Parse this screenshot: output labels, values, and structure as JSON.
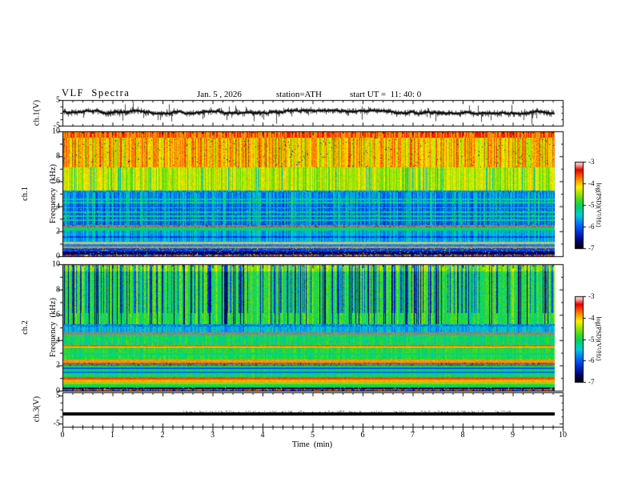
{
  "header": {
    "title": "VLF  Spectra",
    "date": "Jan. 5 , 2026",
    "station": "station=ATH",
    "start_ut": "start UT =  11: 40: 0"
  },
  "x_axis": {
    "label": "Time  (min)",
    "tick_labels": [
      "0",
      "1",
      "2",
      "3",
      "4",
      "5",
      "6",
      "7",
      "8",
      "9",
      "10"
    ]
  },
  "panels": {
    "ch1_wave": {
      "ylabel": "ch.1(V)",
      "ytick_labels": [
        "5",
        "-5"
      ]
    },
    "ch1_spec": {
      "ylabel_line1": "ch.1",
      "ylabel_line2": "Frequency  (kHz)",
      "ytick_labels": [
        "10",
        "8",
        "6",
        "4",
        "2",
        "0"
      ]
    },
    "ch2_spec": {
      "ylabel_line1": "ch.2",
      "ylabel_line2": "Frequency  (kHz)",
      "ytick_labels": [
        "10",
        "8",
        "6",
        "4",
        "2",
        "0"
      ]
    },
    "ch3_wave": {
      "ylabel": "ch.3(V)",
      "ytick_labels": [
        "5",
        "-5"
      ]
    }
  },
  "colorbars": {
    "label": "log(PSD)(V²/Hz)",
    "tick_labels": [
      "-3",
      "-4",
      "-5",
      "-6",
      "-7"
    ]
  },
  "chart_data": {
    "type": "heatmap",
    "title": "VLF Spectra",
    "date": "Jan. 5, 2026",
    "station": "ATH",
    "start_ut": "11:40:0",
    "xlabel": "Time (min)",
    "x_range": [
      0,
      10
    ],
    "data_time_extent_min": [
      0,
      9.8
    ],
    "panels": [
      {
        "type": "line",
        "name": "ch.1 waveform",
        "ylabel": "ch.1(V)",
        "ylim": [
          -5,
          5
        ],
        "summary": "Continuous broadband noisy voltage trace centered near +0.4 V with ~±1 V envelope and frequent impulsive spikes reaching -5 and +5 V over 0–9.8 min"
      },
      {
        "type": "heatmap",
        "name": "ch.1 spectrogram",
        "ylabel": "Frequency (kHz)",
        "ylim": [
          0,
          10
        ],
        "colorbar_label": "log(PSD)(V²/Hz)",
        "colorbar_range": [
          -7,
          -3
        ],
        "bands": [
          {
            "f_khz": [
              9.6,
              10.0
            ],
            "log_psd": -3.5,
            "note": "solid red/orange band"
          },
          {
            "f_khz": [
              7.2,
              9.6
            ],
            "log_psd": -4.0,
            "note": "orange-yellow with red and green vertical streaks"
          },
          {
            "f_khz": [
              5.3,
              7.2
            ],
            "log_psd": -4.4,
            "note": "yellow-green with dense green vertical striations"
          },
          {
            "f_khz": [
              5.1,
              5.3
            ],
            "log_psd": -6.2,
            "note": "dark horizontal line"
          },
          {
            "f_khz": [
              2.5,
              5.1
            ],
            "log_psd": -5.8,
            "note": "blue region, navy vertical streaks, cyan lines near 2.9/3.2/3.6/3.9/4.6 kHz"
          },
          {
            "f_khz": [
              2.3,
              2.5
            ],
            "log_psd": -4.8,
            "note": "grey-brown band"
          },
          {
            "f_khz": [
              2.05,
              2.3
            ],
            "log_psd": -5.1,
            "note": "cyan-green line"
          },
          {
            "f_khz": [
              1.1,
              2.05
            ],
            "log_psd": -5.6,
            "note": "blue speckle"
          },
          {
            "f_khz": [
              0.95,
              1.1
            ],
            "log_psd": -4.4,
            "note": "pale yellow-grey band"
          },
          {
            "f_khz": [
              0.6,
              0.72
            ],
            "log_psd": -3.8,
            "note": "orange line"
          },
          {
            "f_khz": [
              0.1,
              0.6
            ],
            "log_psd": -6.6,
            "note": "near-black band with sparse bright speckle"
          },
          {
            "f_khz": [
              0.0,
              0.1
            ],
            "log_psd": -5.5,
            "note": "mixed colored edge line"
          }
        ]
      },
      {
        "type": "heatmap",
        "name": "ch.2 spectrogram",
        "ylabel": "Frequency (kHz)",
        "ylim": [
          0,
          10
        ],
        "colorbar_label": "log(PSD)(V²/Hz)",
        "colorbar_range": [
          -7,
          -3
        ],
        "bands": [
          {
            "f_khz": [
              5.3,
              10.0
            ],
            "log_psd": -4.9,
            "note": "green/cyan with many dark navy-black vertical dropout streaks to -7"
          },
          {
            "f_khz": [
              5.1,
              5.3
            ],
            "log_psd": -6.2,
            "note": "dark horizontal line"
          },
          {
            "f_khz": [
              4.6,
              5.1
            ],
            "log_psd": -5.6,
            "note": "blue-cyan speckle band"
          },
          {
            "f_khz": [
              4.45,
              4.6
            ],
            "log_psd": -4.8,
            "note": "grey band"
          },
          {
            "f_khz": [
              3.65,
              4.45
            ],
            "log_psd": -5.0,
            "note": "green with blue speckle"
          },
          {
            "f_khz": [
              3.4,
              3.65
            ],
            "log_psd": -3.8,
            "note": "orange-red line over yellow"
          },
          {
            "f_khz": [
              2.45,
              3.4
            ],
            "log_psd": -4.9,
            "note": "green speckle"
          },
          {
            "f_khz": [
              2.25,
              2.45
            ],
            "log_psd": -3.9,
            "note": "orange line"
          },
          {
            "f_khz": [
              2.0,
              2.25
            ],
            "log_psd": -5.2,
            "note": "grey-dark band"
          },
          {
            "f_khz": [
              1.05,
              2.0
            ],
            "log_psd": -5.0,
            "note": "green with dark lines at 1.45 and 1.75 kHz"
          },
          {
            "f_khz": [
              0.88,
              1.05
            ],
            "log_psd": -3.6,
            "note": "strong red line"
          },
          {
            "f_khz": [
              0.7,
              0.88
            ],
            "log_psd": -3.9,
            "note": "orange line"
          },
          {
            "f_khz": [
              0.24,
              0.7
            ],
            "log_psd": -4.8,
            "note": "green, orange dash near 0.58 kHz"
          },
          {
            "f_khz": [
              0.1,
              0.24
            ],
            "log_psd": -6.9,
            "note": "black band"
          },
          {
            "f_khz": [
              0.0,
              0.1
            ],
            "log_psd": -3.7,
            "note": "thin red edge line"
          }
        ]
      },
      {
        "type": "line",
        "name": "ch.3 waveform",
        "ylabel": "ch.3(V)",
        "ylim": [
          -5,
          5
        ],
        "summary": "Flat constant thick black trace near -1.5 V (no signal) spanning 0–9.8 min"
      }
    ]
  }
}
